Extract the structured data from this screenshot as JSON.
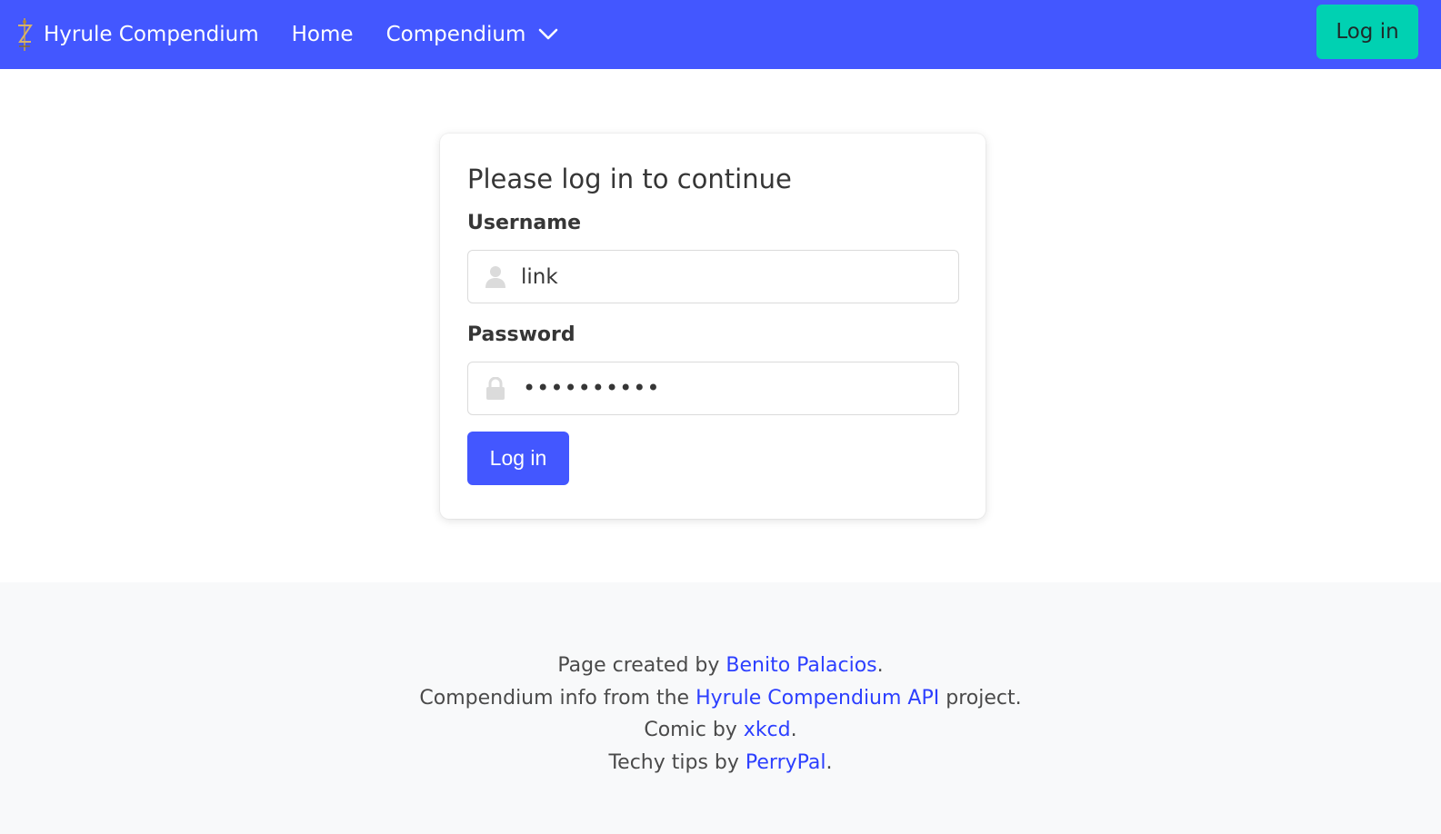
{
  "navbar": {
    "brand_label": "Hyrule Compendium",
    "brand_icon": "master-sword-icon",
    "home_label": "Home",
    "compendium_label": "Compendium",
    "login_label": "Log in",
    "bg_color": "#4357ff",
    "login_color": "#00d1b2"
  },
  "login_card": {
    "title": "Please log in to continue",
    "username_label": "Username",
    "username_value": "link",
    "username_icon": "user-icon",
    "password_label": "Password",
    "password_masked": "••••••••••",
    "password_icon": "lock-icon",
    "submit_label": "Log in",
    "accent_color": "#4357ff"
  },
  "footer": {
    "line1_prefix": "Page created by ",
    "line1_link": "Benito Palacios",
    "line1_suffix": ".",
    "line2_prefix": "Compendium info from the ",
    "line2_link": "Hyrule Compendium API",
    "line2_suffix": " project.",
    "line3_prefix": "Comic by ",
    "line3_link": "xkcd",
    "line3_suffix": ".",
    "line4_prefix": "Techy tips by ",
    "line4_link": "PerryPal",
    "line4_suffix": ".",
    "link_color": "#2c3fff"
  }
}
